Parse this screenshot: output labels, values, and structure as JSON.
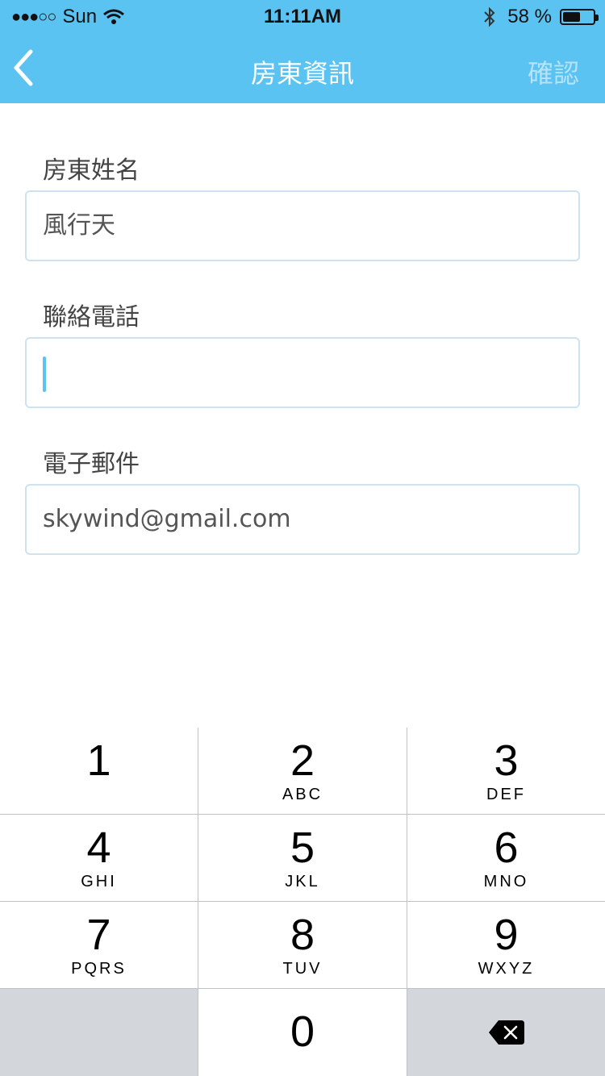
{
  "status_bar": {
    "signal_dots": "●●●○○",
    "carrier": "Sun",
    "time": "11:11AM",
    "battery_percent": "58 %",
    "battery_level": 0.58
  },
  "nav": {
    "title": "房東資訊",
    "confirm_label": "確認",
    "back_icon": "chevron-left-icon"
  },
  "form": {
    "name_label": "房東姓名",
    "name_value": "風行天",
    "phone_label": "聯絡電話",
    "phone_value": "",
    "email_label": "電子郵件",
    "email_value": "skywind@gmail.com"
  },
  "keypad": {
    "keys": [
      {
        "num": "1",
        "letters": ""
      },
      {
        "num": "2",
        "letters": "ABC"
      },
      {
        "num": "3",
        "letters": "DEF"
      },
      {
        "num": "4",
        "letters": "GHI"
      },
      {
        "num": "5",
        "letters": "JKL"
      },
      {
        "num": "6",
        "letters": "MNO"
      },
      {
        "num": "7",
        "letters": "PQRS"
      },
      {
        "num": "8",
        "letters": "TUV"
      },
      {
        "num": "9",
        "letters": "WXYZ"
      }
    ],
    "zero": "0",
    "delete_icon": "backspace-icon"
  },
  "colors": {
    "accent": "#5ac3f1",
    "confirm_disabled": "#b7e2f8",
    "field_border": "#cfe2f0",
    "key_dark": "#d3d6db"
  }
}
